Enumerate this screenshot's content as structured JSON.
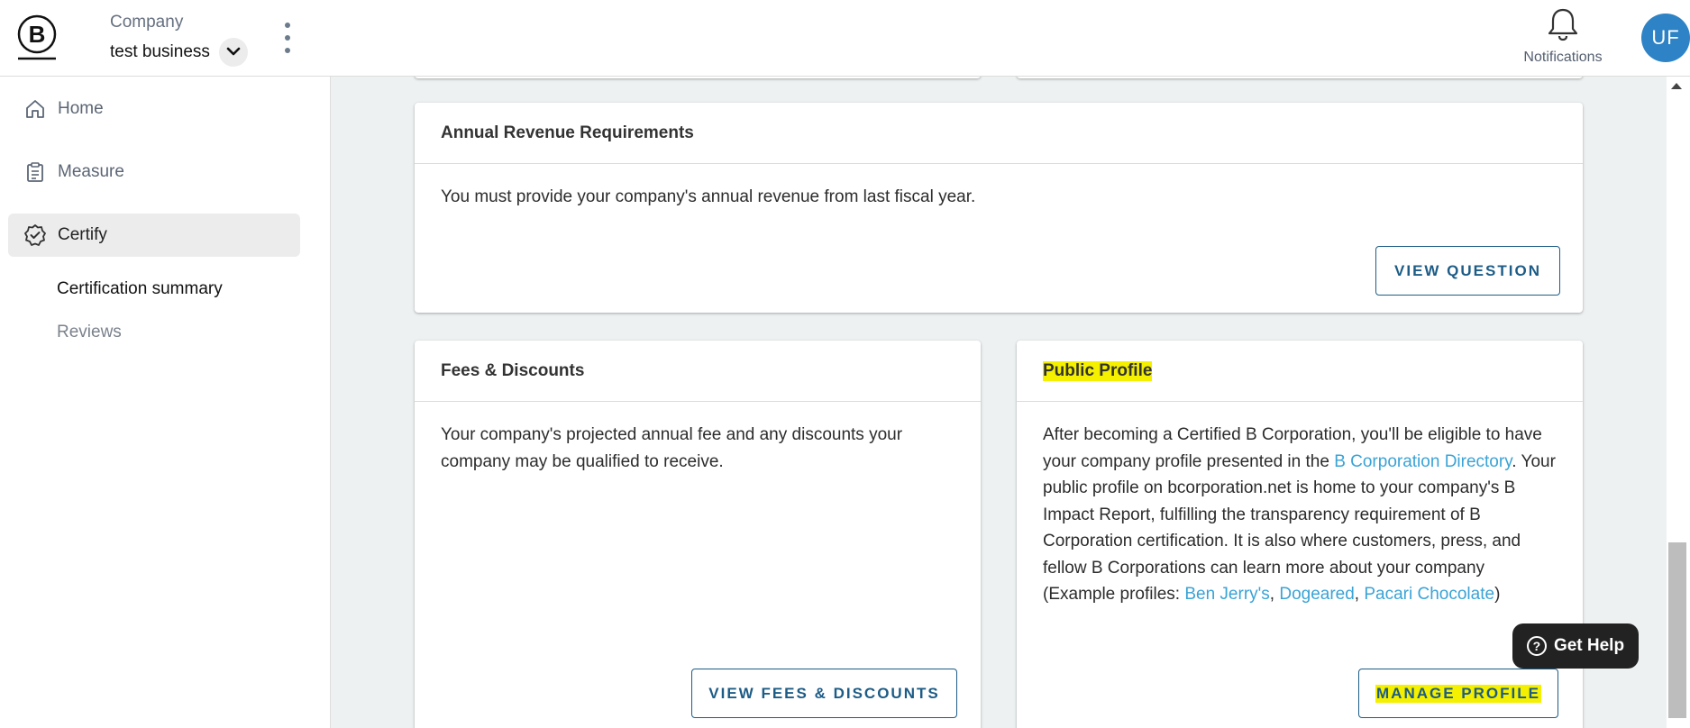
{
  "header": {
    "company_label": "Company",
    "company_name": "test business",
    "notifications_label": "Notifications",
    "avatar_initials": "UF"
  },
  "sidebar": {
    "items": [
      {
        "label": "Home",
        "icon": "home-icon"
      },
      {
        "label": "Measure",
        "icon": "clipboard-icon"
      },
      {
        "label": "Certify",
        "icon": "badge-check-icon",
        "active": true
      }
    ],
    "sub_items": [
      {
        "label": "Certification summary",
        "current": true
      },
      {
        "label": "Reviews",
        "current": false
      }
    ]
  },
  "cards": {
    "annual_revenue": {
      "title": "Annual Revenue Requirements",
      "body": "You must provide your company's annual revenue from last fiscal year.",
      "button": "VIEW QUESTION"
    },
    "fees": {
      "title": "Fees & Discounts",
      "body": "Your company's projected annual fee and any discounts your company may be qualified to receive.",
      "button": "VIEW FEES & DISCOUNTS"
    },
    "public_profile": {
      "title": "Public Profile",
      "body_1": "After becoming a Certified B Corporation, you'll be eligible to have your company profile presented in the ",
      "link_directory": "B Corporation Directory",
      "body_2": ". Your public profile on bcorporation.net is home to your company's B Impact Report, fulfilling the transparency requirement of B Corporation certification. It is also where customers, press, and fellow B Corporations can learn more about your company (Example profiles: ",
      "link_1": "Ben Jerry's",
      "sep_1": ", ",
      "link_2": "Dogeared",
      "sep_2": ", ",
      "link_3": "Pacari Chocolate",
      "body_3": ")",
      "button": "MANAGE PROFILE"
    }
  },
  "help": {
    "label": "Get Help"
  },
  "colors": {
    "accent": "#1d5c86",
    "link": "#3aa3d6",
    "highlight": "#f4f000",
    "avatar": "#2d83c5",
    "main_bg": "#edf1f2"
  }
}
